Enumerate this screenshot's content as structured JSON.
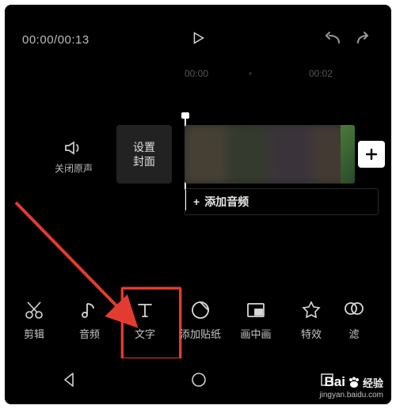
{
  "header": {
    "timecode": "00:00/00:13"
  },
  "ticks": {
    "t0": "00:00",
    "t2": "00:02",
    "dot": "•"
  },
  "mute": {
    "label": "关闭原声"
  },
  "cover": {
    "line1": "设置",
    "line2": "封面"
  },
  "audio": {
    "plus": "+",
    "label": "添加音频"
  },
  "tools": [
    {
      "key": "edit",
      "label": "剪辑"
    },
    {
      "key": "audio",
      "label": "音频"
    },
    {
      "key": "text",
      "label": "文字"
    },
    {
      "key": "sticker",
      "label": "添加贴纸"
    },
    {
      "key": "pip",
      "label": "画中画"
    },
    {
      "key": "effect",
      "label": "特效"
    },
    {
      "key": "filter",
      "label": "滤"
    }
  ],
  "watermark": {
    "brand_a": "Bai",
    "brand_b": "经验",
    "url": "jingyan.baidu.com"
  },
  "colors": {
    "highlight": "#e33b2f"
  }
}
